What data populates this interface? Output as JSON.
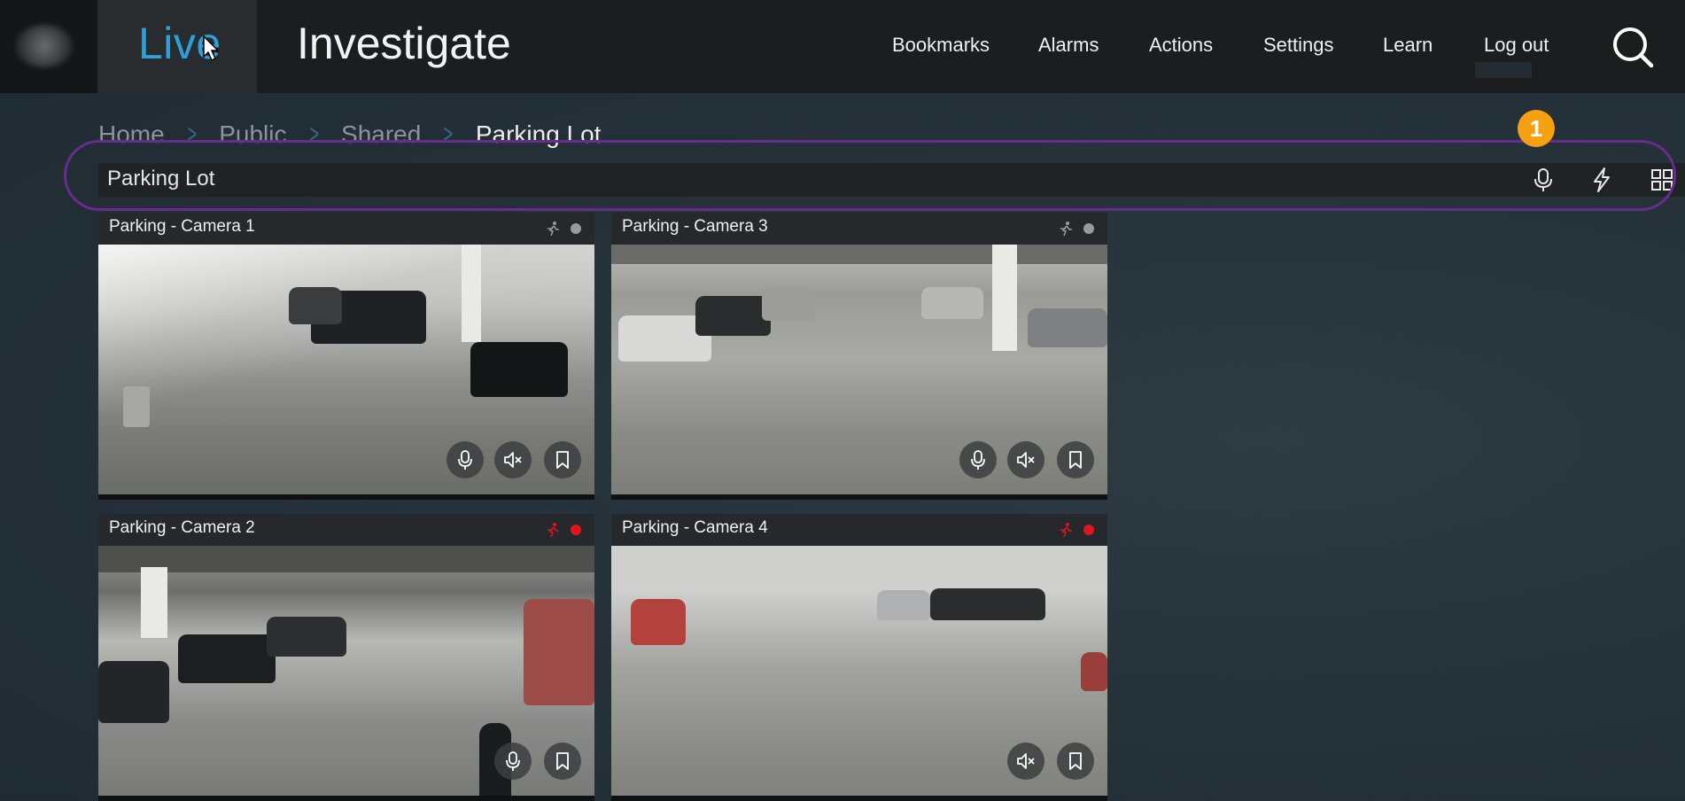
{
  "nav": {
    "live": "Live",
    "investigate": "Investigate",
    "items": [
      "Bookmarks",
      "Alarms",
      "Actions",
      "Settings",
      "Learn",
      "Log out"
    ]
  },
  "breadcrumb": [
    "Home",
    "Public",
    "Shared",
    "Parking Lot"
  ],
  "titlebar": {
    "label": "Parking Lot"
  },
  "badge": "1",
  "colors": {
    "accent": "#2e9fd8",
    "highlight": "#6a2b8e",
    "badge": "#f5a112",
    "recording": "#e0141e"
  },
  "cameras": [
    {
      "name": "Parking - Camera 1",
      "recording": false
    },
    {
      "name": "Parking - Camera 3",
      "recording": false
    },
    {
      "name": "Parking - Camera 2",
      "recording": true
    },
    {
      "name": "Parking - Camera 4",
      "recording": true
    }
  ]
}
